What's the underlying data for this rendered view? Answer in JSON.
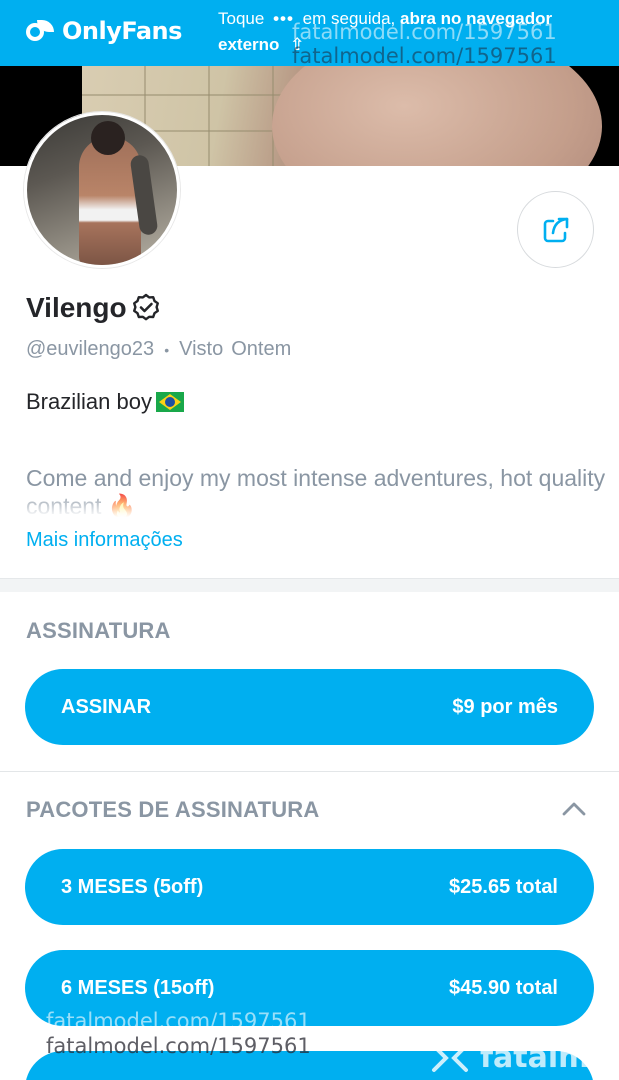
{
  "banner": {
    "logo_text": "OnlyFans",
    "msg_prefix": "Toque",
    "dots_glyph": "•••",
    "msg_middle": "em seguida,",
    "msg_bold": "abra no navegador externo",
    "watermark": "fatalmodel.com/1597561"
  },
  "profile": {
    "name": "Vilengo",
    "verified_icon": "verified-badge-icon",
    "handle": "@euvilengo23",
    "separator": "•",
    "last_seen_label": "Visto",
    "last_seen_value": "Ontem",
    "bio_line1": "Brazilian boy",
    "bio_flag_icon": "brazil-flag-icon",
    "bio_line2": "Come and enjoy my most intense adventures, hot quality content 🔥",
    "more_link": "Mais informações"
  },
  "subscription": {
    "title": "ASSINATURA",
    "button_label": "ASSINAR",
    "button_price": "$9 por mês"
  },
  "bundles": {
    "title": "PACOTES DE ASSINATURA",
    "items": [
      {
        "label": "3 MESES (5off)",
        "price": "$25.65 total"
      },
      {
        "label": "6 MESES (15off)",
        "price": "$45.90 total"
      }
    ]
  },
  "watermark_bottom": "fatalmodel.com/1597561",
  "watermark_brand": "fatalmo",
  "colors": {
    "accent": "#00aff0",
    "text": "#242529",
    "muted": "#8a96a3"
  }
}
